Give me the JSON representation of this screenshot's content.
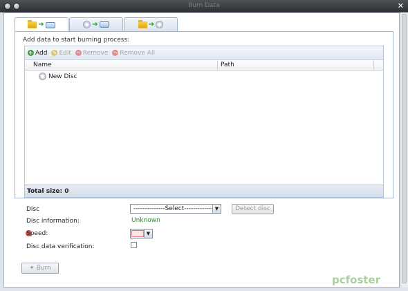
{
  "window": {
    "title": "Burn Data"
  },
  "tabs": [
    {
      "name": "add-data-tab"
    },
    {
      "name": "copy-disc-tab"
    },
    {
      "name": "image-tab"
    }
  ],
  "panel": {
    "title": "Add data to start burning process:",
    "toolbar": {
      "add": "Add",
      "edit": "Edit",
      "remove": "Remove",
      "remove_all": "Remove All"
    },
    "columns": {
      "name": "Name",
      "path": "Path"
    },
    "items": [
      {
        "label": "New Disc"
      }
    ],
    "total": "Total size: 0"
  },
  "form": {
    "disc_label": "Disc",
    "disc_select": "--------------Select---------------",
    "detect_button": "Detect disc",
    "disc_info_label": "Disc information:",
    "disc_info_value": "Unknown",
    "speed_label": "Speed:",
    "verify_label": "Disc data verification:"
  },
  "actions": {
    "burn": "Burn"
  },
  "watermark": "pcfoster",
  "colors": {
    "accent": "#2a9a2f",
    "unknown_text": "#2b8a2b",
    "error": "#d9534f"
  }
}
